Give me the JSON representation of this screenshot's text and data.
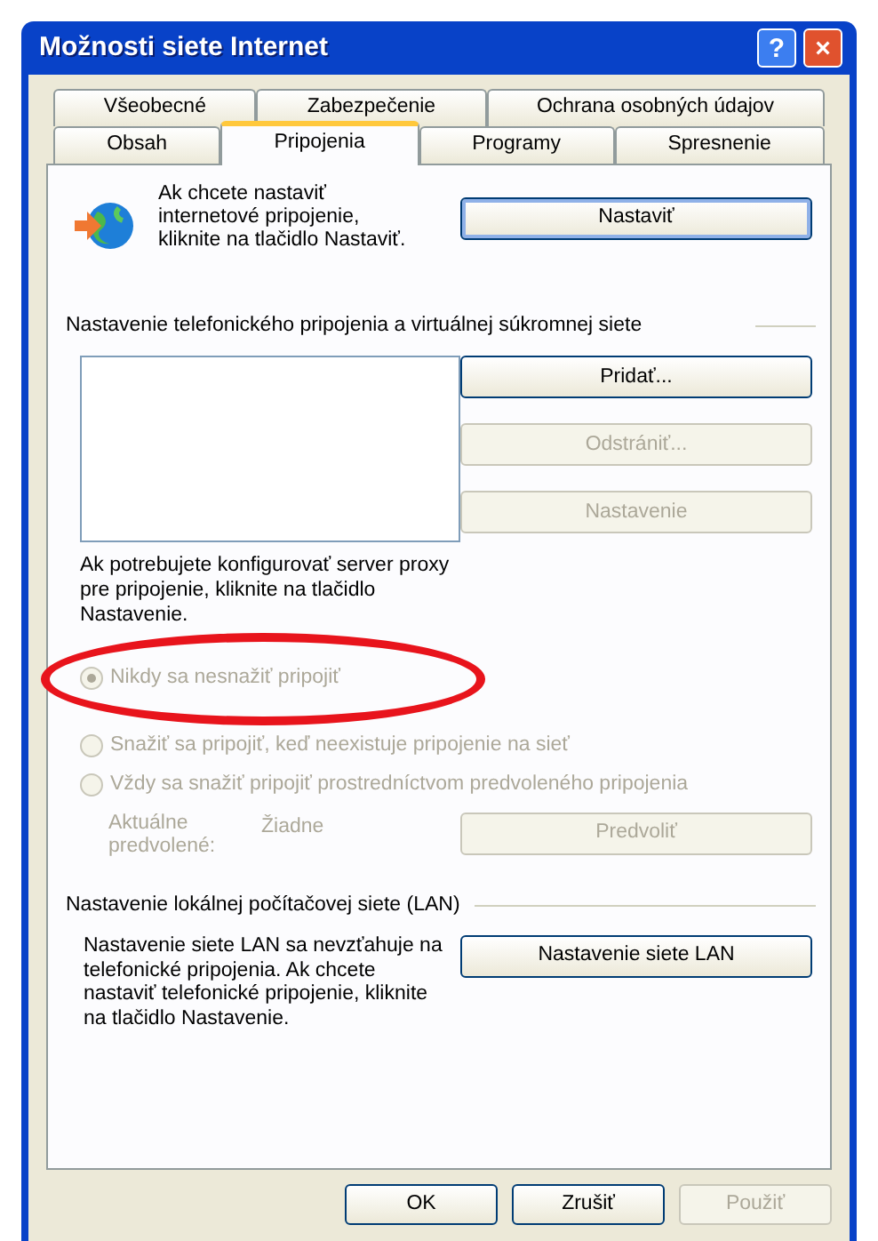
{
  "window": {
    "title": "Možnosti siete Internet",
    "title_buttons": [
      "?",
      "×"
    ]
  },
  "tabs": [
    [
      {
        "label": "Všeobecné",
        "selected": false
      },
      {
        "label": "Zabezpečenie",
        "selected": false
      },
      {
        "label": "Ochrana osobných údajov",
        "selected": false
      }
    ],
    [
      {
        "label": "Obsah",
        "selected": false
      },
      {
        "label": "Pripojenia",
        "selected": true
      },
      {
        "label": "Programy",
        "selected": false
      },
      {
        "label": "Spresnenie",
        "selected": false
      }
    ]
  ],
  "setup": {
    "text": "Ak chcete nastaviť internetové pripojenie, kliknite na tlačidlo Nastaviť.",
    "button": {
      "label": "Nastaviť",
      "disabled": false
    }
  },
  "dialup": {
    "heading": "Nastavenie telefonického pripojenia a virtuálnej súkromnej siete",
    "buttons": [
      {
        "label": "Pridať...",
        "disabled": false
      },
      {
        "label": "Odstrániť...",
        "disabled": true
      },
      {
        "label": "Nastavenie",
        "disabled": true
      }
    ],
    "proxy_text": "Ak potrebujete konfigurovať server proxy pre pripojenie, kliknite na tlačidlo Nastavenie.",
    "radios": [
      {
        "label": "Nikdy sa nesnažiť pripojiť",
        "selected": true,
        "disabled": true
      },
      {
        "label": "Snažiť sa pripojiť, keď neexistuje pripojenie na sieť",
        "selected": false,
        "disabled": true
      },
      {
        "label": "Vždy sa snažiť pripojiť prostredníctvom predvoleného pripojenia",
        "selected": false,
        "disabled": true
      }
    ],
    "current_label": "Aktuálne predvolené:",
    "current_value": "Žiadne",
    "default_button": {
      "label": "Predvoliť",
      "disabled": true
    }
  },
  "lan": {
    "heading": "Nastavenie lokálnej počítačovej siete (LAN)",
    "text": "Nastavenie siete LAN sa nevzťahuje na telefonické pripojenia. Ak chcete nastaviť telefonické pripojenie, kliknite na tlačidlo Nastavenie.",
    "button": {
      "label": "Nastavenie siete LAN",
      "disabled": false
    }
  },
  "footer_buttons": [
    {
      "label": "OK",
      "disabled": false
    },
    {
      "label": "Zrušiť",
      "disabled": false
    },
    {
      "label": "Použiť",
      "disabled": true
    }
  ]
}
